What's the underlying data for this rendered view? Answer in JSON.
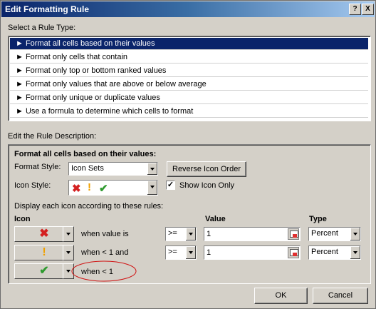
{
  "window": {
    "title": "Edit Formatting Rule",
    "help": "?",
    "close": "X"
  },
  "rule_type": {
    "label": "Select a Rule Type:",
    "items": [
      "► Format all cells based on their values",
      "► Format only cells that contain",
      "► Format only top or bottom ranked values",
      "► Format only values that are above or below average",
      "► Format only unique or duplicate values",
      "► Use a formula to determine which cells to format"
    ],
    "selected_index": 0
  },
  "description": {
    "label": "Edit the Rule Description:",
    "heading": "Format all cells based on their values:",
    "format_style_label": "Format Style:",
    "format_style_value": "Icon Sets",
    "reverse_icon_order": "Reverse Icon Order",
    "icon_style_label": "Icon Style:",
    "show_icon_only_label": "Show Icon Only",
    "show_icon_only_checked": true,
    "display_rules_label": "Display each icon according to these rules:",
    "col_icon": "Icon",
    "col_value": "Value",
    "col_type": "Type",
    "rows": [
      {
        "icon": "✖",
        "icon_name": "red-x-icon",
        "condition": "when value is",
        "operator": ">=",
        "value": "1",
        "type": "Percent"
      },
      {
        "icon": "!",
        "icon_name": "yellow-exclamation-icon",
        "condition": "when < 1 and",
        "operator": ">=",
        "value": "1",
        "type": "Percent"
      },
      {
        "icon": "✔",
        "icon_name": "green-check-icon",
        "condition": "when < 1"
      }
    ]
  },
  "footer": {
    "ok": "OK",
    "cancel": "Cancel"
  },
  "colors": {
    "red": "#d42020",
    "yellow": "#f0a000",
    "green": "#2e9a2e",
    "annotation": "#d01010"
  }
}
